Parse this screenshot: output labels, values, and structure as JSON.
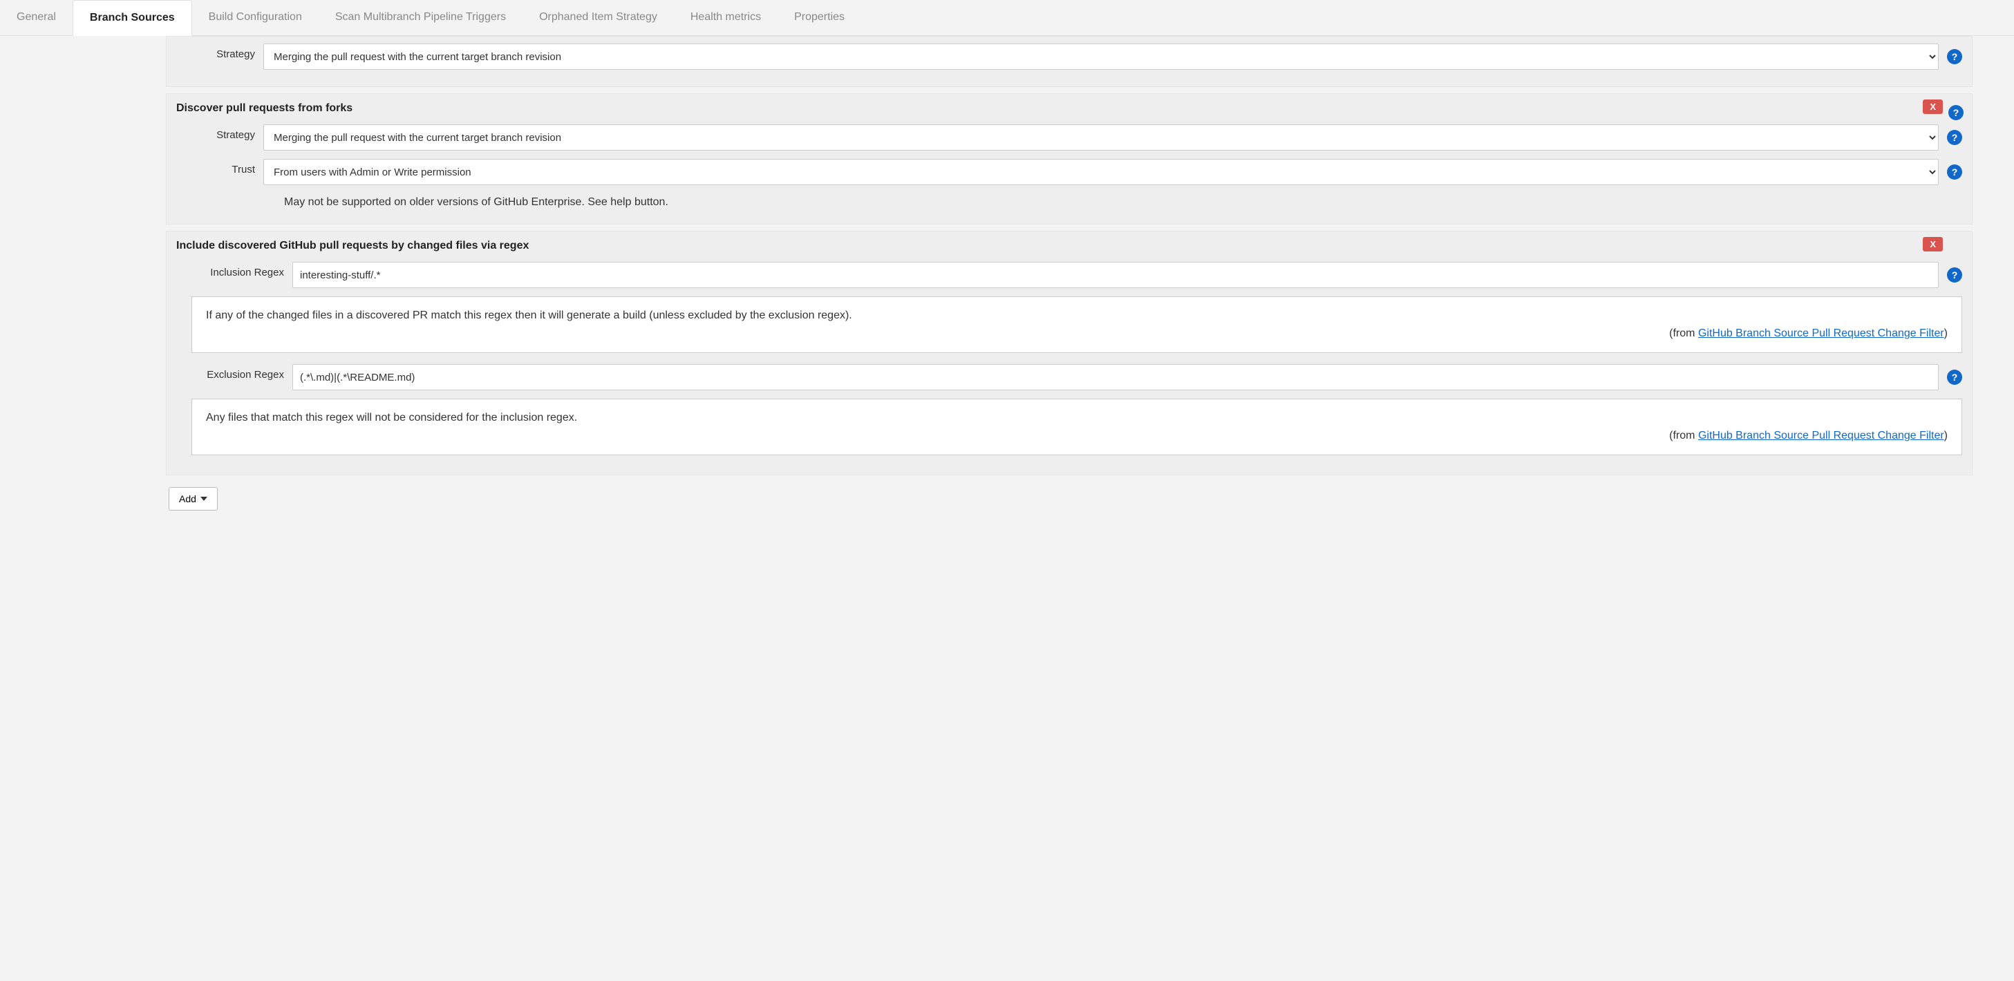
{
  "tabs": {
    "general": "General",
    "branch_sources": "Branch Sources",
    "build_config": "Build Configuration",
    "scan_triggers": "Scan Multibranch Pipeline Triggers",
    "orphaned": "Orphaned Item Strategy",
    "health": "Health metrics",
    "properties": "Properties"
  },
  "section1": {
    "strategy_label": "Strategy",
    "strategy_value": "Merging the pull request with the current target branch revision"
  },
  "section2": {
    "title": "Discover pull requests from forks",
    "strategy_label": "Strategy",
    "strategy_value": "Merging the pull request with the current target branch revision",
    "trust_label": "Trust",
    "trust_value": "From users with Admin or Write permission",
    "hint": "May not be supported on older versions of GitHub Enterprise. See help button."
  },
  "section3": {
    "title": "Include discovered GitHub pull requests by changed files via regex",
    "inclusion_label": "Inclusion Regex",
    "inclusion_value": "interesting-stuff/.*",
    "inclusion_desc": "If any of the changed files in a discovered PR match this regex then it will generate a build (unless excluded by the exclusion regex).",
    "exclusion_label": "Exclusion Regex",
    "exclusion_value": "(.*\\.md)|(.*\\README.md)",
    "exclusion_desc": "Any files that match this regex will not be considered for the inclusion regex.",
    "from_text": "(from ",
    "from_link": "GitHub Branch Source Pull Request Change Filter",
    "from_close": ")"
  },
  "delete_label": "X",
  "help_label": "?",
  "add_label": "Add"
}
